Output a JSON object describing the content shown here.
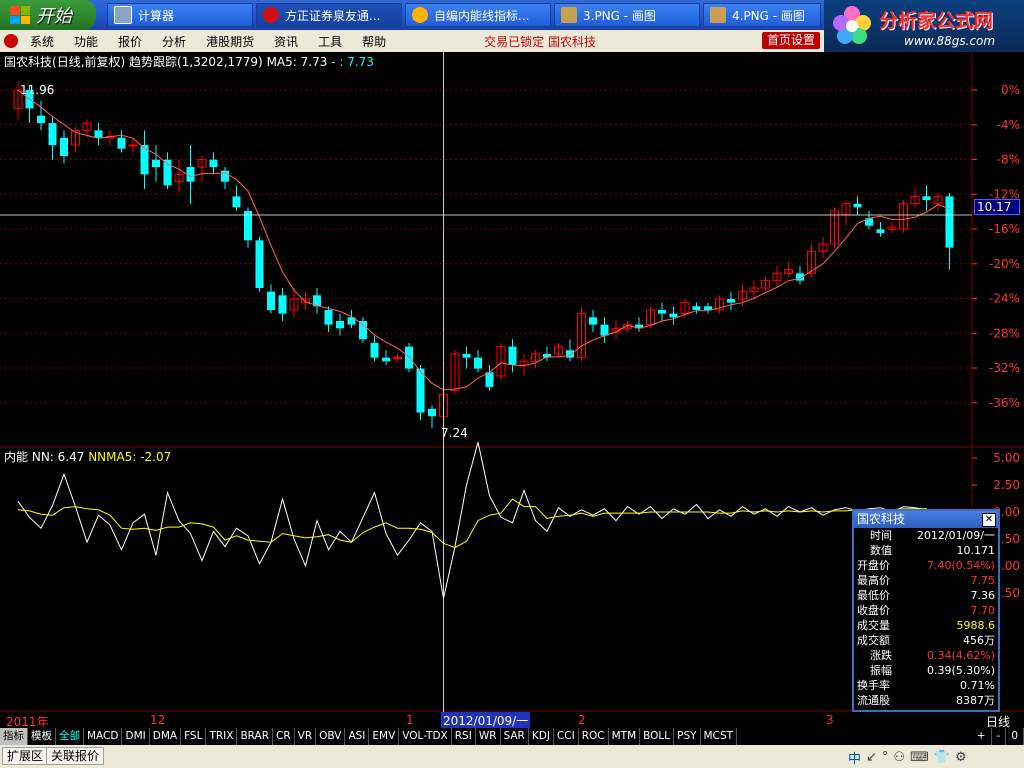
{
  "taskbar": {
    "start_label": "开始",
    "tasks": [
      {
        "label": "计算器",
        "icon": "calculator-icon"
      },
      {
        "label": "方正证券泉友通...",
        "icon": "founder-securities-icon"
      },
      {
        "label": "自编内能线指标...",
        "icon": "browser-icon"
      },
      {
        "label": "3.PNG - 画图",
        "icon": "paint-icon"
      },
      {
        "label": "4.PNG - 画图",
        "icon": "paint-icon"
      }
    ],
    "brand_name": "分析家公式网",
    "brand_url": "www.88gs.com"
  },
  "menu": {
    "items": [
      "系统",
      "功能",
      "报价",
      "分析",
      "港股期货",
      "资讯",
      "工具",
      "帮助"
    ],
    "status_text": "交易已锁定  国农科技",
    "home_button": "首页设置"
  },
  "main_chart": {
    "stock_name": "国农科技",
    "period_label": "(日线,前复权)",
    "indicator_label": "趋势跟踪(1,3202,1779)",
    "ma_label": "MA5: 7.73",
    "ma_extra": "- : 7.73",
    "high_label": "11.96",
    "low_label": "7.24",
    "cursor_price": "10.17"
  },
  "sub_chart": {
    "name": "内能",
    "nn_label": "NN: 6.47",
    "nnma_label": "NNMA5: -2.07"
  },
  "colors": {
    "up": "#ff0000",
    "down": "#00ffff",
    "ma": "#ffff00",
    "grid": "#800000",
    "axis_text": "#ff3030",
    "crosshair": "#ffffff"
  },
  "chart_data": [
    {
      "type": "candlestick",
      "title": "国农科技 (日线,前复权)",
      "y_axis_labels": [
        "0%",
        "-4%",
        "-8%",
        "-12%",
        "-16%",
        "-20%",
        "-24%",
        "-28%",
        "-32%",
        "-36%"
      ],
      "series": [
        {
          "name": "K线",
          "candles": [
            {
              "o": 11.6,
              "h": 11.96,
              "l": 11.45,
              "c": 11.85
            },
            {
              "o": 11.85,
              "h": 11.9,
              "l": 11.4,
              "c": 11.6
            },
            {
              "o": 11.5,
              "h": 11.7,
              "l": 11.3,
              "c": 11.4
            },
            {
              "o": 11.4,
              "h": 11.5,
              "l": 10.9,
              "c": 11.1
            },
            {
              "o": 11.2,
              "h": 11.3,
              "l": 10.85,
              "c": 10.95
            },
            {
              "o": 11.1,
              "h": 11.35,
              "l": 11.0,
              "c": 11.3
            },
            {
              "o": 11.3,
              "h": 11.45,
              "l": 11.2,
              "c": 11.4
            },
            {
              "o": 11.3,
              "h": 11.4,
              "l": 11.1,
              "c": 11.2
            },
            {
              "o": 11.2,
              "h": 11.3,
              "l": 11.1,
              "c": 11.22
            },
            {
              "o": 11.2,
              "h": 11.3,
              "l": 11.0,
              "c": 11.05
            },
            {
              "o": 11.1,
              "h": 11.2,
              "l": 11.0,
              "c": 11.1
            },
            {
              "o": 11.1,
              "h": 11.3,
              "l": 10.5,
              "c": 10.7
            },
            {
              "o": 10.9,
              "h": 11.1,
              "l": 10.6,
              "c": 10.8
            },
            {
              "o": 10.9,
              "h": 11.0,
              "l": 10.5,
              "c": 10.55
            },
            {
              "o": 10.6,
              "h": 10.9,
              "l": 10.45,
              "c": 10.7
            },
            {
              "o": 10.8,
              "h": 11.1,
              "l": 10.3,
              "c": 10.6
            },
            {
              "o": 10.8,
              "h": 10.95,
              "l": 10.6,
              "c": 10.9
            },
            {
              "o": 10.9,
              "h": 11.0,
              "l": 10.7,
              "c": 10.8
            },
            {
              "o": 10.75,
              "h": 10.8,
              "l": 10.5,
              "c": 10.6
            },
            {
              "o": 10.4,
              "h": 10.55,
              "l": 10.2,
              "c": 10.25
            },
            {
              "o": 10.2,
              "h": 10.25,
              "l": 9.7,
              "c": 9.8
            },
            {
              "o": 9.8,
              "h": 9.85,
              "l": 9.1,
              "c": 9.15
            },
            {
              "o": 9.1,
              "h": 9.2,
              "l": 8.8,
              "c": 8.85
            },
            {
              "o": 9.05,
              "h": 9.15,
              "l": 8.7,
              "c": 8.8
            },
            {
              "o": 8.85,
              "h": 9.15,
              "l": 8.75,
              "c": 9.0
            },
            {
              "o": 8.95,
              "h": 9.1,
              "l": 8.85,
              "c": 9.0
            },
            {
              "o": 9.05,
              "h": 9.15,
              "l": 8.8,
              "c": 8.9
            },
            {
              "o": 8.85,
              "h": 8.9,
              "l": 8.55,
              "c": 8.65
            },
            {
              "o": 8.7,
              "h": 8.8,
              "l": 8.5,
              "c": 8.6
            },
            {
              "o": 8.75,
              "h": 8.85,
              "l": 8.6,
              "c": 8.65
            },
            {
              "o": 8.7,
              "h": 8.75,
              "l": 8.4,
              "c": 8.45
            },
            {
              "o": 8.4,
              "h": 8.5,
              "l": 8.15,
              "c": 8.2
            },
            {
              "o": 8.2,
              "h": 8.3,
              "l": 8.1,
              "c": 8.15
            },
            {
              "o": 8.2,
              "h": 8.25,
              "l": 8.15,
              "c": 8.2
            },
            {
              "o": 8.35,
              "h": 8.4,
              "l": 8.0,
              "c": 8.05
            },
            {
              "o": 8.05,
              "h": 8.1,
              "l": 7.35,
              "c": 7.45
            },
            {
              "o": 7.5,
              "h": 7.55,
              "l": 7.24,
              "c": 7.4
            },
            {
              "o": 7.4,
              "h": 7.75,
              "l": 7.36,
              "c": 7.7
            },
            {
              "o": 7.75,
              "h": 8.3,
              "l": 7.7,
              "c": 8.25
            },
            {
              "o": 8.25,
              "h": 8.35,
              "l": 8.05,
              "c": 8.2
            },
            {
              "o": 8.2,
              "h": 8.3,
              "l": 8.0,
              "c": 8.05
            },
            {
              "o": 8.0,
              "h": 8.1,
              "l": 7.75,
              "c": 7.8
            },
            {
              "o": 7.95,
              "h": 8.4,
              "l": 7.9,
              "c": 8.35
            },
            {
              "o": 8.35,
              "h": 8.45,
              "l": 8.0,
              "c": 8.1
            },
            {
              "o": 8.1,
              "h": 8.25,
              "l": 7.95,
              "c": 8.15
            },
            {
              "o": 8.15,
              "h": 8.3,
              "l": 8.05,
              "c": 8.25
            },
            {
              "o": 8.25,
              "h": 8.35,
              "l": 8.15,
              "c": 8.2
            },
            {
              "o": 8.25,
              "h": 8.4,
              "l": 8.2,
              "c": 8.35
            },
            {
              "o": 8.3,
              "h": 8.45,
              "l": 8.15,
              "c": 8.2
            },
            {
              "o": 8.2,
              "h": 8.9,
              "l": 8.15,
              "c": 8.8
            },
            {
              "o": 8.75,
              "h": 8.85,
              "l": 8.55,
              "c": 8.65
            },
            {
              "o": 8.65,
              "h": 8.75,
              "l": 8.4,
              "c": 8.5
            },
            {
              "o": 8.55,
              "h": 8.7,
              "l": 8.45,
              "c": 8.6
            },
            {
              "o": 8.6,
              "h": 8.7,
              "l": 8.55,
              "c": 8.65
            },
            {
              "o": 8.65,
              "h": 8.75,
              "l": 8.55,
              "c": 8.6
            },
            {
              "o": 8.65,
              "h": 8.9,
              "l": 8.6,
              "c": 8.85
            },
            {
              "o": 8.85,
              "h": 8.95,
              "l": 8.7,
              "c": 8.8
            },
            {
              "o": 8.8,
              "h": 8.9,
              "l": 8.65,
              "c": 8.75
            },
            {
              "o": 8.8,
              "h": 9.0,
              "l": 8.75,
              "c": 8.95
            },
            {
              "o": 8.9,
              "h": 8.95,
              "l": 8.8,
              "c": 8.85
            },
            {
              "o": 8.9,
              "h": 8.95,
              "l": 8.8,
              "c": 8.85
            },
            {
              "o": 8.85,
              "h": 9.05,
              "l": 8.8,
              "c": 9.0
            },
            {
              "o": 9.0,
              "h": 9.1,
              "l": 8.85,
              "c": 8.95
            },
            {
              "o": 9.0,
              "h": 9.2,
              "l": 8.9,
              "c": 9.1
            },
            {
              "o": 9.1,
              "h": 9.25,
              "l": 9.0,
              "c": 9.15
            },
            {
              "o": 9.15,
              "h": 9.3,
              "l": 9.1,
              "c": 9.25
            },
            {
              "o": 9.25,
              "h": 9.45,
              "l": 9.15,
              "c": 9.35
            },
            {
              "o": 9.35,
              "h": 9.5,
              "l": 9.3,
              "c": 9.4
            },
            {
              "o": 9.35,
              "h": 9.45,
              "l": 9.2,
              "c": 9.25
            },
            {
              "o": 9.35,
              "h": 9.75,
              "l": 9.3,
              "c": 9.65
            },
            {
              "o": 9.65,
              "h": 9.85,
              "l": 9.55,
              "c": 9.75
            },
            {
              "o": 9.75,
              "h": 10.25,
              "l": 9.7,
              "c": 10.2
            },
            {
              "o": 10.15,
              "h": 10.35,
              "l": 10.0,
              "c": 10.3
            },
            {
              "o": 10.3,
              "h": 10.4,
              "l": 10.15,
              "c": 10.25
            },
            {
              "o": 10.1,
              "h": 10.2,
              "l": 9.95,
              "c": 10.0
            },
            {
              "o": 9.95,
              "h": 10.05,
              "l": 9.85,
              "c": 9.9
            },
            {
              "o": 9.95,
              "h": 10.05,
              "l": 9.9,
              "c": 9.98
            },
            {
              "o": 9.95,
              "h": 10.35,
              "l": 9.9,
              "c": 10.3
            },
            {
              "o": 10.3,
              "h": 10.5,
              "l": 10.25,
              "c": 10.4
            },
            {
              "o": 10.4,
              "h": 10.55,
              "l": 10.2,
              "c": 10.35
            },
            {
              "o": 10.3,
              "h": 10.45,
              "l": 10.2,
              "c": 10.4
            },
            {
              "o": 10.4,
              "h": 10.45,
              "l": 9.4,
              "c": 9.7
            }
          ]
        },
        {
          "name": "MA5"
        }
      ]
    },
    {
      "type": "line",
      "title": "内能",
      "y_axis_labels": [
        "5.00",
        "2.50",
        "0.00",
        "-2.50",
        "-5.00",
        "-7.50"
      ],
      "series": [
        {
          "name": "NN",
          "values": [
            1.0,
            -0.5,
            -1.5,
            0.6,
            3.5,
            0.5,
            -2.8,
            -0.3,
            -1.2,
            -3.5,
            -1.0,
            -0.2,
            -4.0,
            1.8,
            -0.8,
            -2.0,
            -4.5,
            -1.8,
            -3.2,
            -1.5,
            -2.2,
            -4.8,
            -2.8,
            1.2,
            -2.5,
            -5.0,
            -0.8,
            -3.5,
            -1.8,
            -2.8,
            -0.5,
            1.8,
            -2.0,
            -4.0,
            -2.6,
            -1.0,
            -1.8,
            -8.0,
            -3.2,
            2.5,
            6.47,
            1.5,
            -0.5,
            -1.0,
            2.0,
            -0.8,
            -1.8,
            0.4,
            -0.4,
            0.2,
            -0.3,
            0.3,
            -0.8,
            0.5,
            -0.2,
            0.5,
            -0.6,
            0.3,
            -0.2,
            0.7,
            -0.6,
            0.2,
            -0.4,
            0.5,
            -0.2,
            0.3,
            -0.4,
            0.5,
            0.0,
            0.4,
            -0.3,
            0.2,
            0.4,
            0.1,
            0.3,
            0.4,
            0.0,
            0.5,
            0.4,
            0.2,
            -0.5
          ]
        },
        {
          "name": "NNMA5",
          "values": [
            0.2,
            0.1,
            -0.2,
            -0.3,
            0.4,
            0.5,
            0.3,
            0.2,
            -0.3,
            -1.5,
            -1.6,
            -1.5,
            -1.7,
            -1.4,
            -1.4,
            -1.0,
            -1.1,
            -1.4,
            -2.6,
            -2.2,
            -2.6,
            -2.7,
            -2.8,
            -2.0,
            -2.2,
            -2.4,
            -2.3,
            -2.1,
            -2.6,
            -2.8,
            -1.9,
            -1.4,
            -1.0,
            -1.5,
            -1.5,
            -1.6,
            -1.9,
            -2.9,
            -3.3,
            -2.7,
            -0.8,
            -0.3,
            -0.1,
            1.2,
            0.5,
            0.5,
            -0.6,
            -0.4,
            -0.3,
            -0.1,
            -0.4,
            -0.1,
            -0.1,
            -0.1,
            -0.1,
            0.0,
            0.0,
            0.0,
            0.0,
            0.0,
            0.0,
            -0.1,
            -0.1,
            0.1,
            0.0,
            0.1,
            0.0,
            0.1,
            0.0,
            0.1,
            0.0,
            0.1,
            0.1,
            0.2,
            0.2,
            0.2,
            0.2,
            0.3,
            0.3,
            0.3,
            -2.07
          ]
        }
      ]
    }
  ],
  "popup": {
    "title": "国农科技",
    "rows": [
      {
        "k": "时间",
        "v": "2012/01/09/一",
        "c": "#ffffff",
        "indent": true
      },
      {
        "k": "数值",
        "v": "10.171",
        "c": "#ffffff",
        "indent": true
      },
      {
        "k": "开盘价",
        "v": "7.40(0.54%)",
        "c": "#ff3030",
        "indent": false
      },
      {
        "k": "最高价",
        "v": "7.75",
        "c": "#ff3030",
        "indent": false
      },
      {
        "k": "最低价",
        "v": "7.36",
        "c": "#ffffff",
        "indent": false
      },
      {
        "k": "收盘价",
        "v": "7.70",
        "c": "#ff3030",
        "indent": false
      },
      {
        "k": "成交量",
        "v": "5988.6",
        "c": "#ffff00",
        "indent": false
      },
      {
        "k": "成交额",
        "v": "456万",
        "c": "#ffffff",
        "indent": false
      },
      {
        "k": "涨跌",
        "v": "0.34(4.62%)",
        "c": "#ff3030",
        "indent": true
      },
      {
        "k": "振幅",
        "v": "0.39(5.30%)",
        "c": "#ffffff",
        "indent": true
      },
      {
        "k": "换手率",
        "v": "0.71%",
        "c": "#ffffff",
        "indent": false
      },
      {
        "k": "流通股",
        "v": "8387万",
        "c": "#ffffff",
        "indent": false
      }
    ]
  },
  "time_axis": {
    "labels": [
      "2011年",
      "12",
      "1",
      "2012/01/09/一",
      "2",
      "3"
    ],
    "period": "日线"
  },
  "indicator_tabs": [
    "指标",
    "模板",
    "全部",
    "MACD",
    "DMI",
    "DMA",
    "FSL",
    "TRIX",
    "BRAR",
    "CR",
    "VR",
    "OBV",
    "ASI",
    "EMV",
    "VOL-TDX",
    "RSI",
    "WR",
    "SAR",
    "KDJ",
    "CCI",
    "ROC",
    "MTM",
    "BOLL",
    "PSY",
    "MCST"
  ],
  "tab_controls": [
    "+",
    "-",
    "0"
  ],
  "footer": {
    "buttons": [
      "扩展区",
      "关联报价"
    ],
    "tray": [
      "中",
      "↙",
      "°",
      "⚇",
      "⌨",
      "👕",
      "⚙"
    ]
  }
}
